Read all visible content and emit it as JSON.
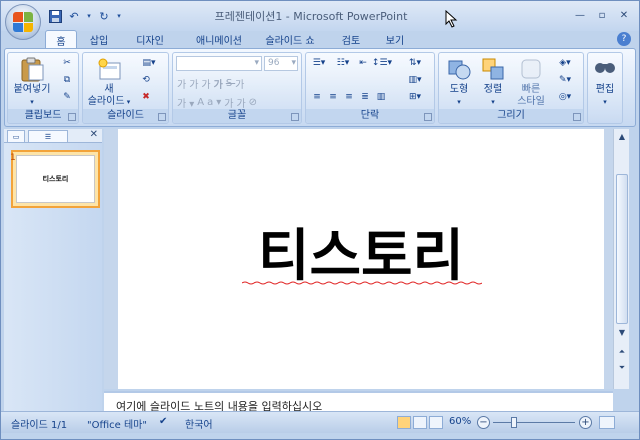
{
  "title": "프레젠테이션1 - Microsoft PowerPoint",
  "tabs": [
    "홈",
    "삽입",
    "디자인",
    "애니메이션",
    "슬라이드 쇼",
    "검토",
    "보기"
  ],
  "active_tab": "홈",
  "groups": {
    "clipboard": {
      "label": "클립보드",
      "paste_label": "붙여넣기"
    },
    "slides": {
      "label": "슬라이드",
      "new_slide_label_1": "새",
      "new_slide_label_2": "슬라이드"
    },
    "font": {
      "label": "글꼴",
      "size_value": "96"
    },
    "paragraph": {
      "label": "단락"
    },
    "drawing": {
      "label": "그리기",
      "shape_label": "도형",
      "arrange_label": "정렬",
      "quick_style_1": "빠른",
      "quick_style_2": "스타일"
    },
    "editing": {
      "label": "편집"
    }
  },
  "slide": {
    "title_text": "티스토리",
    "number": "1",
    "thumb_text": "티스토리"
  },
  "notes": {
    "placeholder": "여기에 슬라이드 노트의 내용을 입력하십시오"
  },
  "status": {
    "slide_info": "슬라이드 1/1",
    "theme": "\"Office 테마\"",
    "language": "한국어",
    "zoom": "60%"
  },
  "colors": {
    "accent": "#15428b",
    "ribbon_bg": "#d6e4f6",
    "selection": "#f2a33a"
  }
}
